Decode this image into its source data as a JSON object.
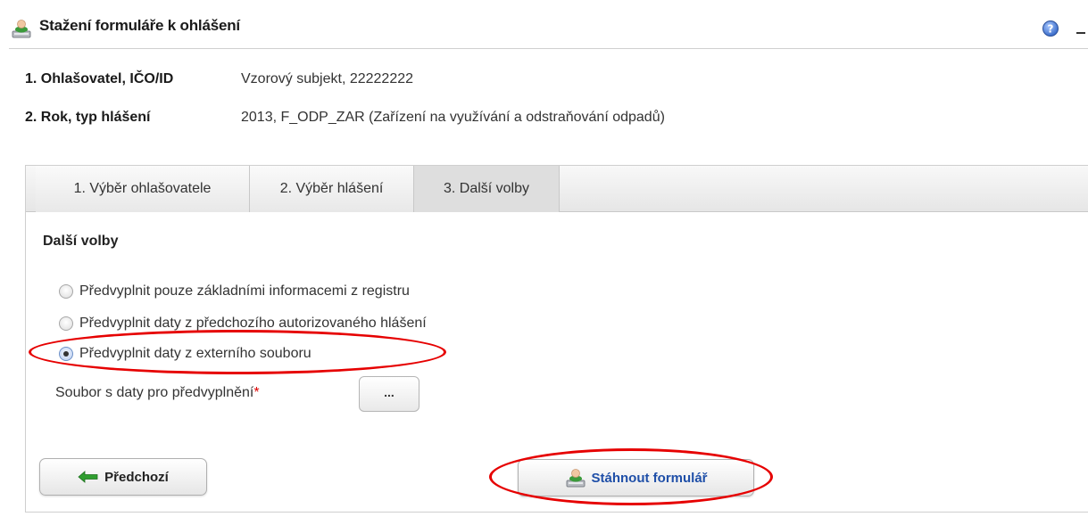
{
  "header": {
    "title": "Stažení formuláře k ohlášení",
    "icon": "user-computer-icon",
    "help_icon": "help-icon",
    "minimize_icon": "minimize-icon"
  },
  "info": {
    "reporter_label": "1. Ohlašovatel, IČO/ID",
    "reporter_value": "Vzorový subjekt, 22222222",
    "year_label": "2. Rok, typ hlášení",
    "year_value": "2013, F_ODP_ZAR (Zařízení na využívání a odstraňování odpadů)"
  },
  "tabs": [
    {
      "label": "1. Výběr ohlašovatele"
    },
    {
      "label": "2. Výběr hlášení"
    },
    {
      "label": "3. Další volby",
      "active": true
    }
  ],
  "section_title": "Další volby",
  "options": [
    {
      "label": "Předvyplnit pouze základními informacemi z registru",
      "checked": false
    },
    {
      "label": "Předvyplnit daty z předchozího autorizovaného hlášení",
      "checked": false
    },
    {
      "label": "Předvyplnit daty z externího souboru",
      "checked": true
    }
  ],
  "file": {
    "label": "Soubor s daty pro předvyplnění",
    "required_mark": "*",
    "browse_label": "..."
  },
  "buttons": {
    "prev_label": "Předchozí",
    "download_label": "Stáhnout formulář"
  },
  "colors": {
    "highlight": "#e60000",
    "link_blue": "#1f4fa8",
    "arrow_green": "#2f9e2f"
  }
}
